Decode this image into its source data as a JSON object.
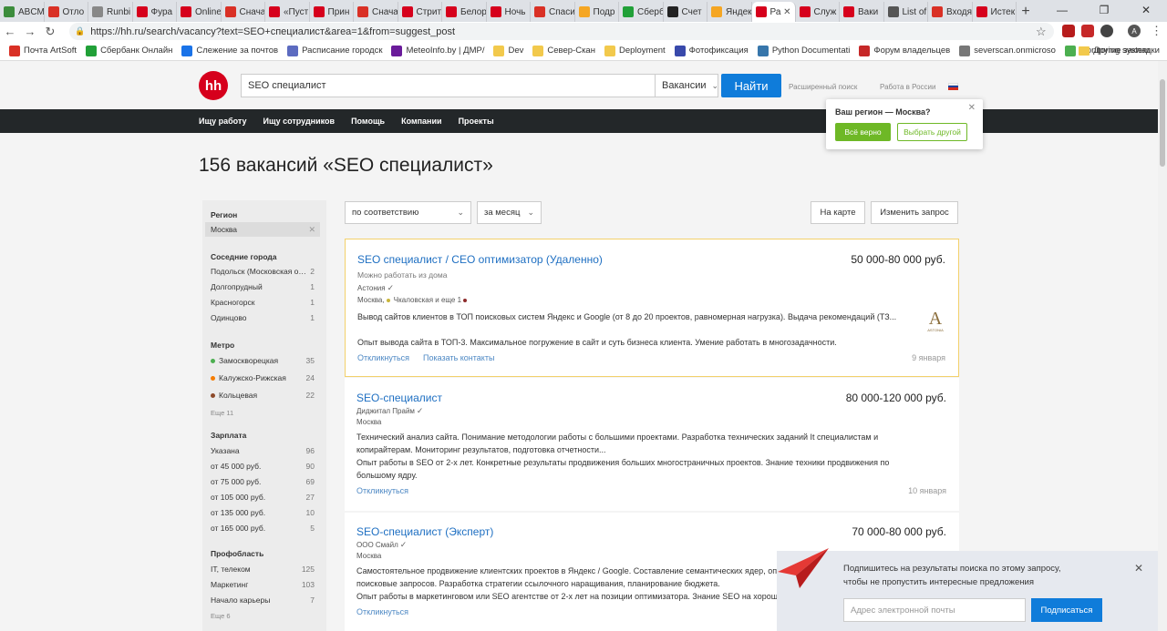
{
  "browser": {
    "tabs": [
      {
        "label": "ABCM",
        "color": "#3c8c3c"
      },
      {
        "label": "Отло",
        "color": "#d93025"
      },
      {
        "label": "Runbi",
        "color": "#888888"
      },
      {
        "label": "Фура",
        "color": "#d6001c"
      },
      {
        "label": "Online",
        "color": "#d6001c"
      },
      {
        "label": "Снача",
        "color": "#d93025"
      },
      {
        "label": "«Пуст",
        "color": "#d6001c"
      },
      {
        "label": "Прин",
        "color": "#d6001c"
      },
      {
        "label": "Снача",
        "color": "#d93025"
      },
      {
        "label": "Стрит",
        "color": "#d6001c"
      },
      {
        "label": "Белор",
        "color": "#d6001c"
      },
      {
        "label": "Ночь",
        "color": "#d6001c"
      },
      {
        "label": "Спаси",
        "color": "#d93025"
      },
      {
        "label": "Подр",
        "color": "#f5a623"
      },
      {
        "label": "Сберб",
        "color": "#21a038"
      },
      {
        "label": "Счет",
        "color": "#222222"
      },
      {
        "label": "Яндек",
        "color": "#f5a623"
      },
      {
        "label": "Ра",
        "color": "#d6001c"
      },
      {
        "label": "Служ",
        "color": "#d6001c"
      },
      {
        "label": "Ваки",
        "color": "#d6001c"
      },
      {
        "label": "List of",
        "color": "#555555"
      },
      {
        "label": "Входя",
        "color": "#d93025"
      },
      {
        "label": "Истек",
        "color": "#d6001c"
      }
    ],
    "active_tab_index": 17,
    "url": "https://hh.ru/search/vacancy?text=SEO+специалист&area=1&from=suggest_post",
    "bookmarks": [
      {
        "label": "Почта ArtSoft",
        "color": "#d93025"
      },
      {
        "label": "Сбербанк Онлайн",
        "color": "#21a038"
      },
      {
        "label": "Слежение за почтов",
        "color": "#1a73e8"
      },
      {
        "label": "Расписание городск",
        "color": "#5c6bc0"
      },
      {
        "label": "MeteoInfo.by | ДМР/",
        "color": "#6a1b9a"
      },
      {
        "label": "Dev",
        "color": "#f2c94c"
      },
      {
        "label": "Север-Скан",
        "color": "#f2c94c"
      },
      {
        "label": "Deployment",
        "color": "#f2c94c"
      },
      {
        "label": "Фотофиксация",
        "color": "#3949ab"
      },
      {
        "label": "Python Documentati",
        "color": "#3776ab"
      },
      {
        "label": "Форум владельцев",
        "color": "#c62828"
      },
      {
        "label": "severscan.onmicroso",
        "color": "#777777"
      },
      {
        "label": "Monitoring system",
        "color": "#4caf50"
      }
    ],
    "other_bookmarks": "Другие закладки",
    "profile_initial": "A"
  },
  "header": {
    "logo": "hh",
    "search_value": "SEO специалист",
    "search_type": "Вакансии",
    "find_button": "Найти",
    "advanced_search": "Расширенный поиск",
    "work_in_russia": "Работа в России"
  },
  "nav": [
    "Ищу работу",
    "Ищу сотрудников",
    "Помощь",
    "Компании",
    "Проекты"
  ],
  "region_popup": {
    "title": "Ваш регион — Москва?",
    "confirm": "Всё верно",
    "choose_other": "Выбрать другой"
  },
  "page_title": "156 вакансий «SEO специалист»",
  "sidebar": {
    "region_title": "Регион",
    "region_value": "Москва",
    "neighbors_title": "Соседние города",
    "neighbors": [
      {
        "label": "Подольск (Московская об...",
        "count": "2"
      },
      {
        "label": "Долгопрудный",
        "count": "1"
      },
      {
        "label": "Красногорск",
        "count": "1"
      },
      {
        "label": "Одинцово",
        "count": "1"
      }
    ],
    "metro_title": "Метро",
    "metro": [
      {
        "label": "Замоскворецкая",
        "count": "35",
        "color": "#4caf50"
      },
      {
        "label": "Калужско-Рижская",
        "count": "24",
        "color": "#f57c00"
      },
      {
        "label": "Кольцевая",
        "count": "22",
        "color": "#8d4a2a"
      }
    ],
    "metro_more": "Еще 11",
    "salary_title": "Зарплата",
    "salary": [
      {
        "label": "Указана",
        "count": "96"
      },
      {
        "label": "от 45 000 руб.",
        "count": "90"
      },
      {
        "label": "от 75 000 руб.",
        "count": "69"
      },
      {
        "label": "от 105 000 руб.",
        "count": "27"
      },
      {
        "label": "от 135 000 руб.",
        "count": "10"
      },
      {
        "label": "от 165 000 руб.",
        "count": "5"
      }
    ],
    "prof_title": "Профобласть",
    "prof": [
      {
        "label": "IT, телеком",
        "count": "125"
      },
      {
        "label": "Маркетинг",
        "count": "103"
      },
      {
        "label": "Начало карьеры",
        "count": "7"
      }
    ],
    "prof_more": "Еще 6"
  },
  "toolbar": {
    "sort": "по соответствию",
    "period": "за месяц",
    "map_button": "На карте",
    "change_query": "Изменить запрос"
  },
  "vacancies": [
    {
      "title": "SEO специалист / СЕО оптимизатор (Удаленно)",
      "salary": "50 000-80 000 руб.",
      "remote": "Можно работать из дома",
      "company": "Астония",
      "location": "Москва,",
      "metro": "Чкаловская и еще 1",
      "text1": "Вывод сайтов клиентов в ТОП поисковых систем Яндекс и Google (от 8 до 20 проектов, равномерная нагрузка). Выдача рекомендаций (ТЗ...",
      "text2": "Опыт вывода сайта в ТОП-3. Максимальное погружение в сайт и суть бизнеса клиента. Умение работать в многозадачности.",
      "respond": "Откликнуться",
      "contacts": "Показать контакты",
      "date": "9 января",
      "logo_letter": "A",
      "logo_text": "ASTONIA"
    },
    {
      "title": "SEO-специалист",
      "salary": "80 000-120 000 руб.",
      "company": "Диджитал Прайм",
      "location": "Москва",
      "text1": "Технический анализ сайта. Понимание методологии работы с большими проектами. Разработка технических заданий It специалистам и копирайтерам. Мониторинг результатов, подготовка отчетности...",
      "text2": "Опыт работы в SEO от 2-х лет. Конкретные результаты продвижения больших многостраничных проектов. Знание техники продвижения по большому ядру.",
      "respond": "Откликнуться",
      "date": "10 января"
    },
    {
      "title": "SEO-специалист (Эксперт)",
      "salary": "70 000-80 000 руб.",
      "company": "ООО Смайл",
      "location": "Москва",
      "text1": "Самостоятельное продвижение клиентских проектов в Яндекс / Google. Составление семантических ядер, оптимизация сайтов под поисковые запросов. Разработка стратегии ссылочного наращивания, планирование бюджета.",
      "text2": "Опыт работы в маркетинговом или SEO агентстве от 2-х лет на позиции оптимизатора. Знание SEO на хорошем уровне.",
      "respond": "Откликнуться"
    }
  ],
  "subscribe": {
    "text": "Подпишитесь на результаты поиска по этому запросу, чтобы не пропустить интересные предложения",
    "placeholder": "Адрес электронной почты",
    "button": "Подписаться"
  }
}
